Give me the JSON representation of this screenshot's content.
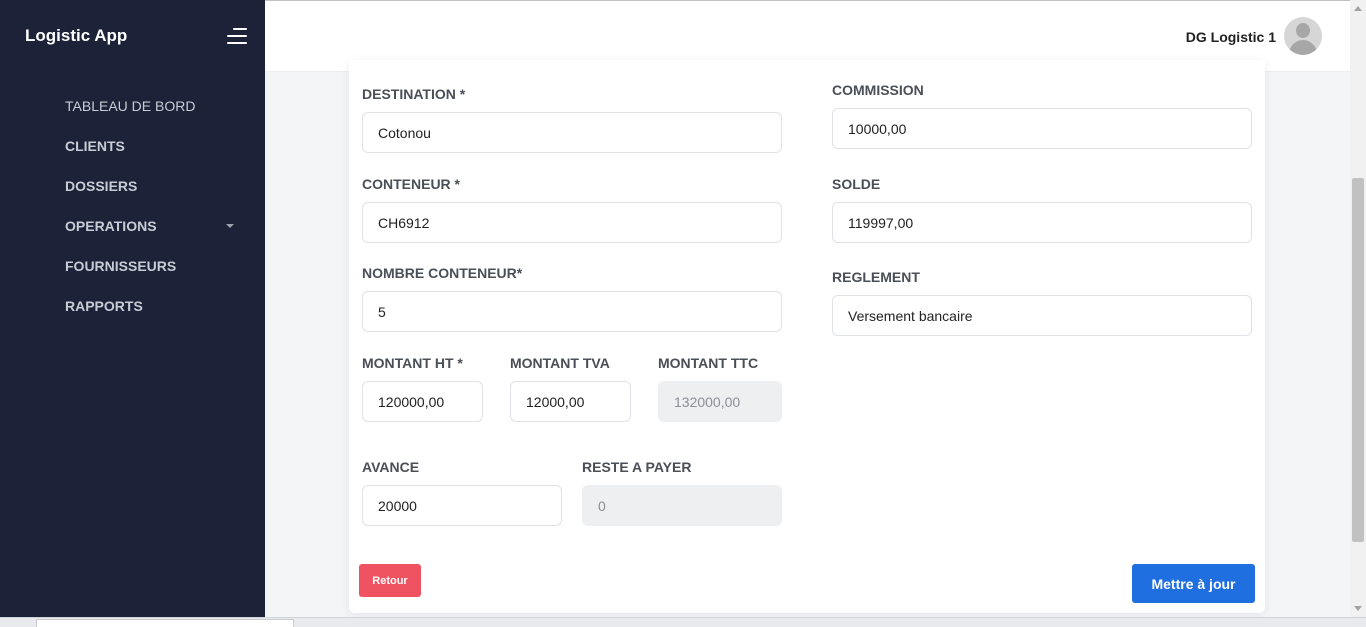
{
  "app": {
    "title": "Logistic App"
  },
  "sidebar": {
    "items": [
      {
        "label": "TABLEAU DE BORD"
      },
      {
        "label": "CLIENTS"
      },
      {
        "label": "DOSSIERS"
      },
      {
        "label": "OPERATIONS"
      },
      {
        "label": "FOURNISSEURS"
      },
      {
        "label": "RAPPORTS"
      }
    ]
  },
  "header": {
    "user_name": "DG Logistic 1"
  },
  "form": {
    "destination": {
      "label": "DESTINATION *",
      "value": "Cotonou"
    },
    "conteneur": {
      "label": "CONTENEUR *",
      "value": "CH6912"
    },
    "nombre_conteneur": {
      "label": "NOMBRE CONTENEUR*",
      "value": "5"
    },
    "montant_ht": {
      "label": "MONTANT HT *",
      "value": "120000,00"
    },
    "montant_tva": {
      "label": "MONTANT TVA",
      "value": "12000,00"
    },
    "montant_ttc": {
      "label": "MONTANT TTC",
      "value": "132000,00"
    },
    "avance": {
      "label": "AVANCE",
      "value": "20000"
    },
    "reste_a_payer": {
      "label": "RESTE A PAYER",
      "value": "0"
    },
    "commission": {
      "label": "COMMISSION",
      "value": "10000,00"
    },
    "solde": {
      "label": "SOLDE",
      "value": "119997,00"
    },
    "reglement": {
      "label": "REGLEMENT",
      "value": "Versement bancaire"
    }
  },
  "actions": {
    "back_label": "Retour",
    "update_label": "Mettre à jour"
  },
  "colors": {
    "sidebar_bg": "#1c2237",
    "primary": "#1f6fe0",
    "danger": "#ef5361"
  }
}
